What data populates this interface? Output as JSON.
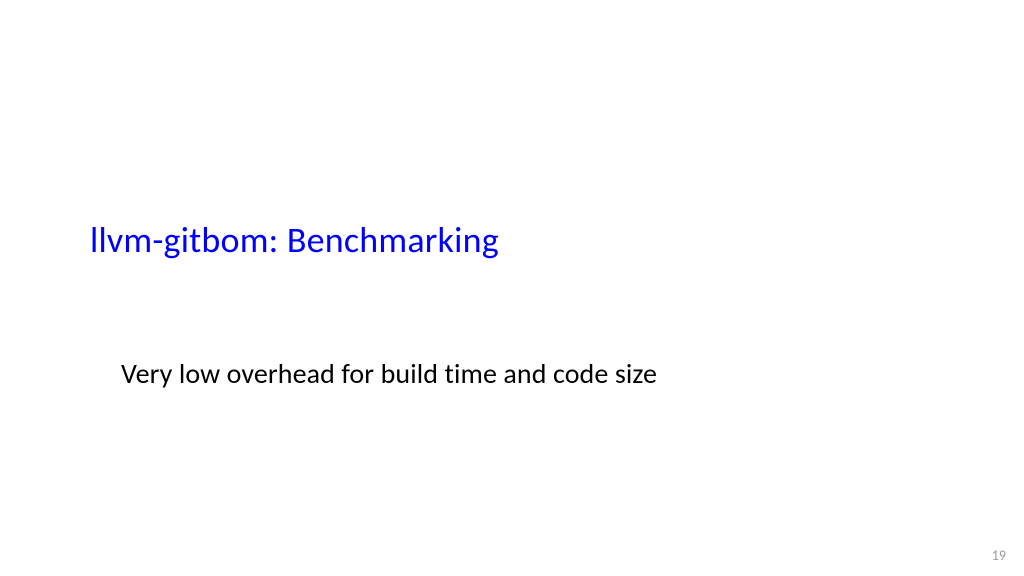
{
  "slide": {
    "title": "llvm-gitbom: Benchmarking",
    "body": "Very low overhead for build time and code size",
    "page_number": "19"
  }
}
